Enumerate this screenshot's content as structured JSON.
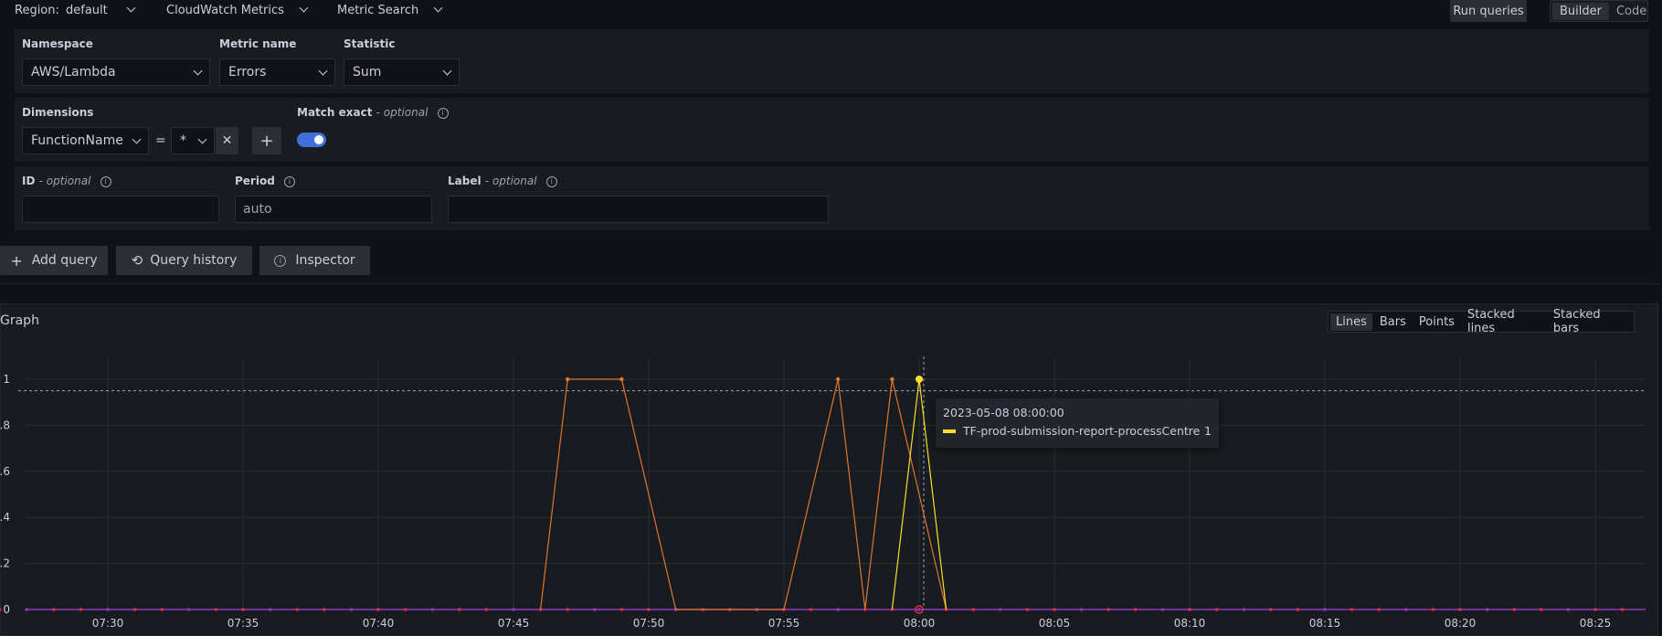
{
  "topbar": {
    "region_label": "Region:",
    "region_value": "default",
    "source": "CloudWatch Metrics",
    "mode": "Metric Search",
    "run_label": "Run queries",
    "builder_label": "Builder",
    "code_label": "Code"
  },
  "query": {
    "namespace_label": "Namespace",
    "namespace_value": "AWS/Lambda",
    "metric_label": "Metric name",
    "metric_value": "Errors",
    "statistic_label": "Statistic",
    "statistic_value": "Sum",
    "dimensions_label": "Dimensions",
    "dimension_key": "FunctionName",
    "dimension_op": "=",
    "dimension_value": "*",
    "match_exact_label": "Match exact",
    "match_exact_optional": "- optional",
    "match_exact_on": true,
    "id_label": "ID",
    "id_optional": "- optional",
    "id_value": "",
    "period_label": "Period",
    "period_placeholder": "auto",
    "label_label": "Label",
    "label_optional": "- optional",
    "label_value": ""
  },
  "actions": {
    "add_query": "Add query",
    "query_history": "Query history",
    "inspector": "Inspector"
  },
  "graph": {
    "title": "Graph",
    "view_options": [
      "Lines",
      "Bars",
      "Points",
      "Stacked lines",
      "Stacked bars"
    ],
    "active_view": "Lines",
    "tooltip_time": "2023-05-08 08:00:00",
    "tooltip_series": "TF-prod-submission-report-processCentre",
    "tooltip_value": "1"
  },
  "colors": {
    "orange": "#e0752d",
    "yellow": "#fade2a",
    "red": "#e02f44",
    "purple": "#8f3bb8",
    "accent": "#3d71d9"
  },
  "chart_data": {
    "type": "line",
    "y_ticks": [
      "0",
      ".2",
      ".4",
      ".6",
      ".8",
      "1"
    ],
    "ylim": [
      0,
      1
    ],
    "x_ticks": [
      "07:30",
      "07:35",
      "07:40",
      "07:45",
      "07:50",
      "07:55",
      "08:00",
      "08:05",
      "08:10",
      "08:15",
      "08:20",
      "08:25"
    ],
    "x_start_minute": 7.0,
    "x_end_minute": 86.0,
    "baseline_value": 0.95,
    "series": [
      {
        "name": "",
        "color": "#e0752d",
        "x": [
          "07:46",
          "07:47",
          "07:49",
          "07:51",
          "07:55",
          "07:57",
          "07:58",
          "07:59",
          "08:00",
          "08:01"
        ],
        "y": [
          0,
          1,
          1,
          0,
          0,
          1,
          0,
          1,
          0.5,
          0
        ]
      },
      {
        "name": "TF-prod-submission-report-processCentre",
        "color": "#fade2a",
        "x": [
          "07:59",
          "08:00",
          "08:01"
        ],
        "y": [
          0,
          1,
          0
        ]
      }
    ]
  }
}
